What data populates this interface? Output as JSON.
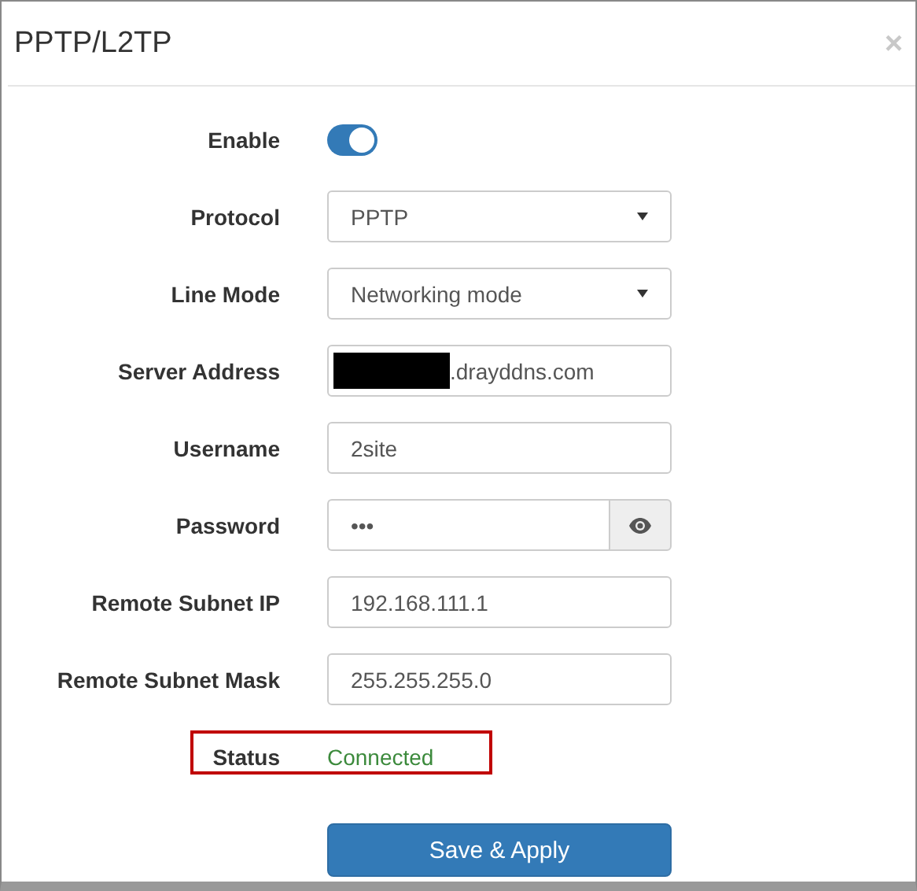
{
  "window": {
    "title": "PPTP/L2TP",
    "close": "×"
  },
  "fields": [
    {
      "kind": "toggle",
      "label": "Enable",
      "on": true
    },
    {
      "kind": "select",
      "label": "Protocol",
      "value": "PPTP"
    },
    {
      "kind": "select",
      "label": "Line Mode",
      "value": "Networking mode"
    },
    {
      "kind": "redacted",
      "label": "Server Address",
      "value": ".drayddns.com"
    },
    {
      "kind": "text",
      "label": "Username",
      "value": "2site"
    },
    {
      "kind": "password",
      "label": "Password",
      "value": "•••"
    },
    {
      "kind": "text",
      "label": "Remote Subnet IP",
      "value": "192.168.111.1"
    },
    {
      "kind": "text",
      "label": "Remote Subnet Mask",
      "value": "255.255.255.0"
    },
    {
      "kind": "status",
      "label": "Status",
      "value": "Connected",
      "highlighted": true
    }
  ],
  "buttons": [
    "Save & Apply"
  ]
}
